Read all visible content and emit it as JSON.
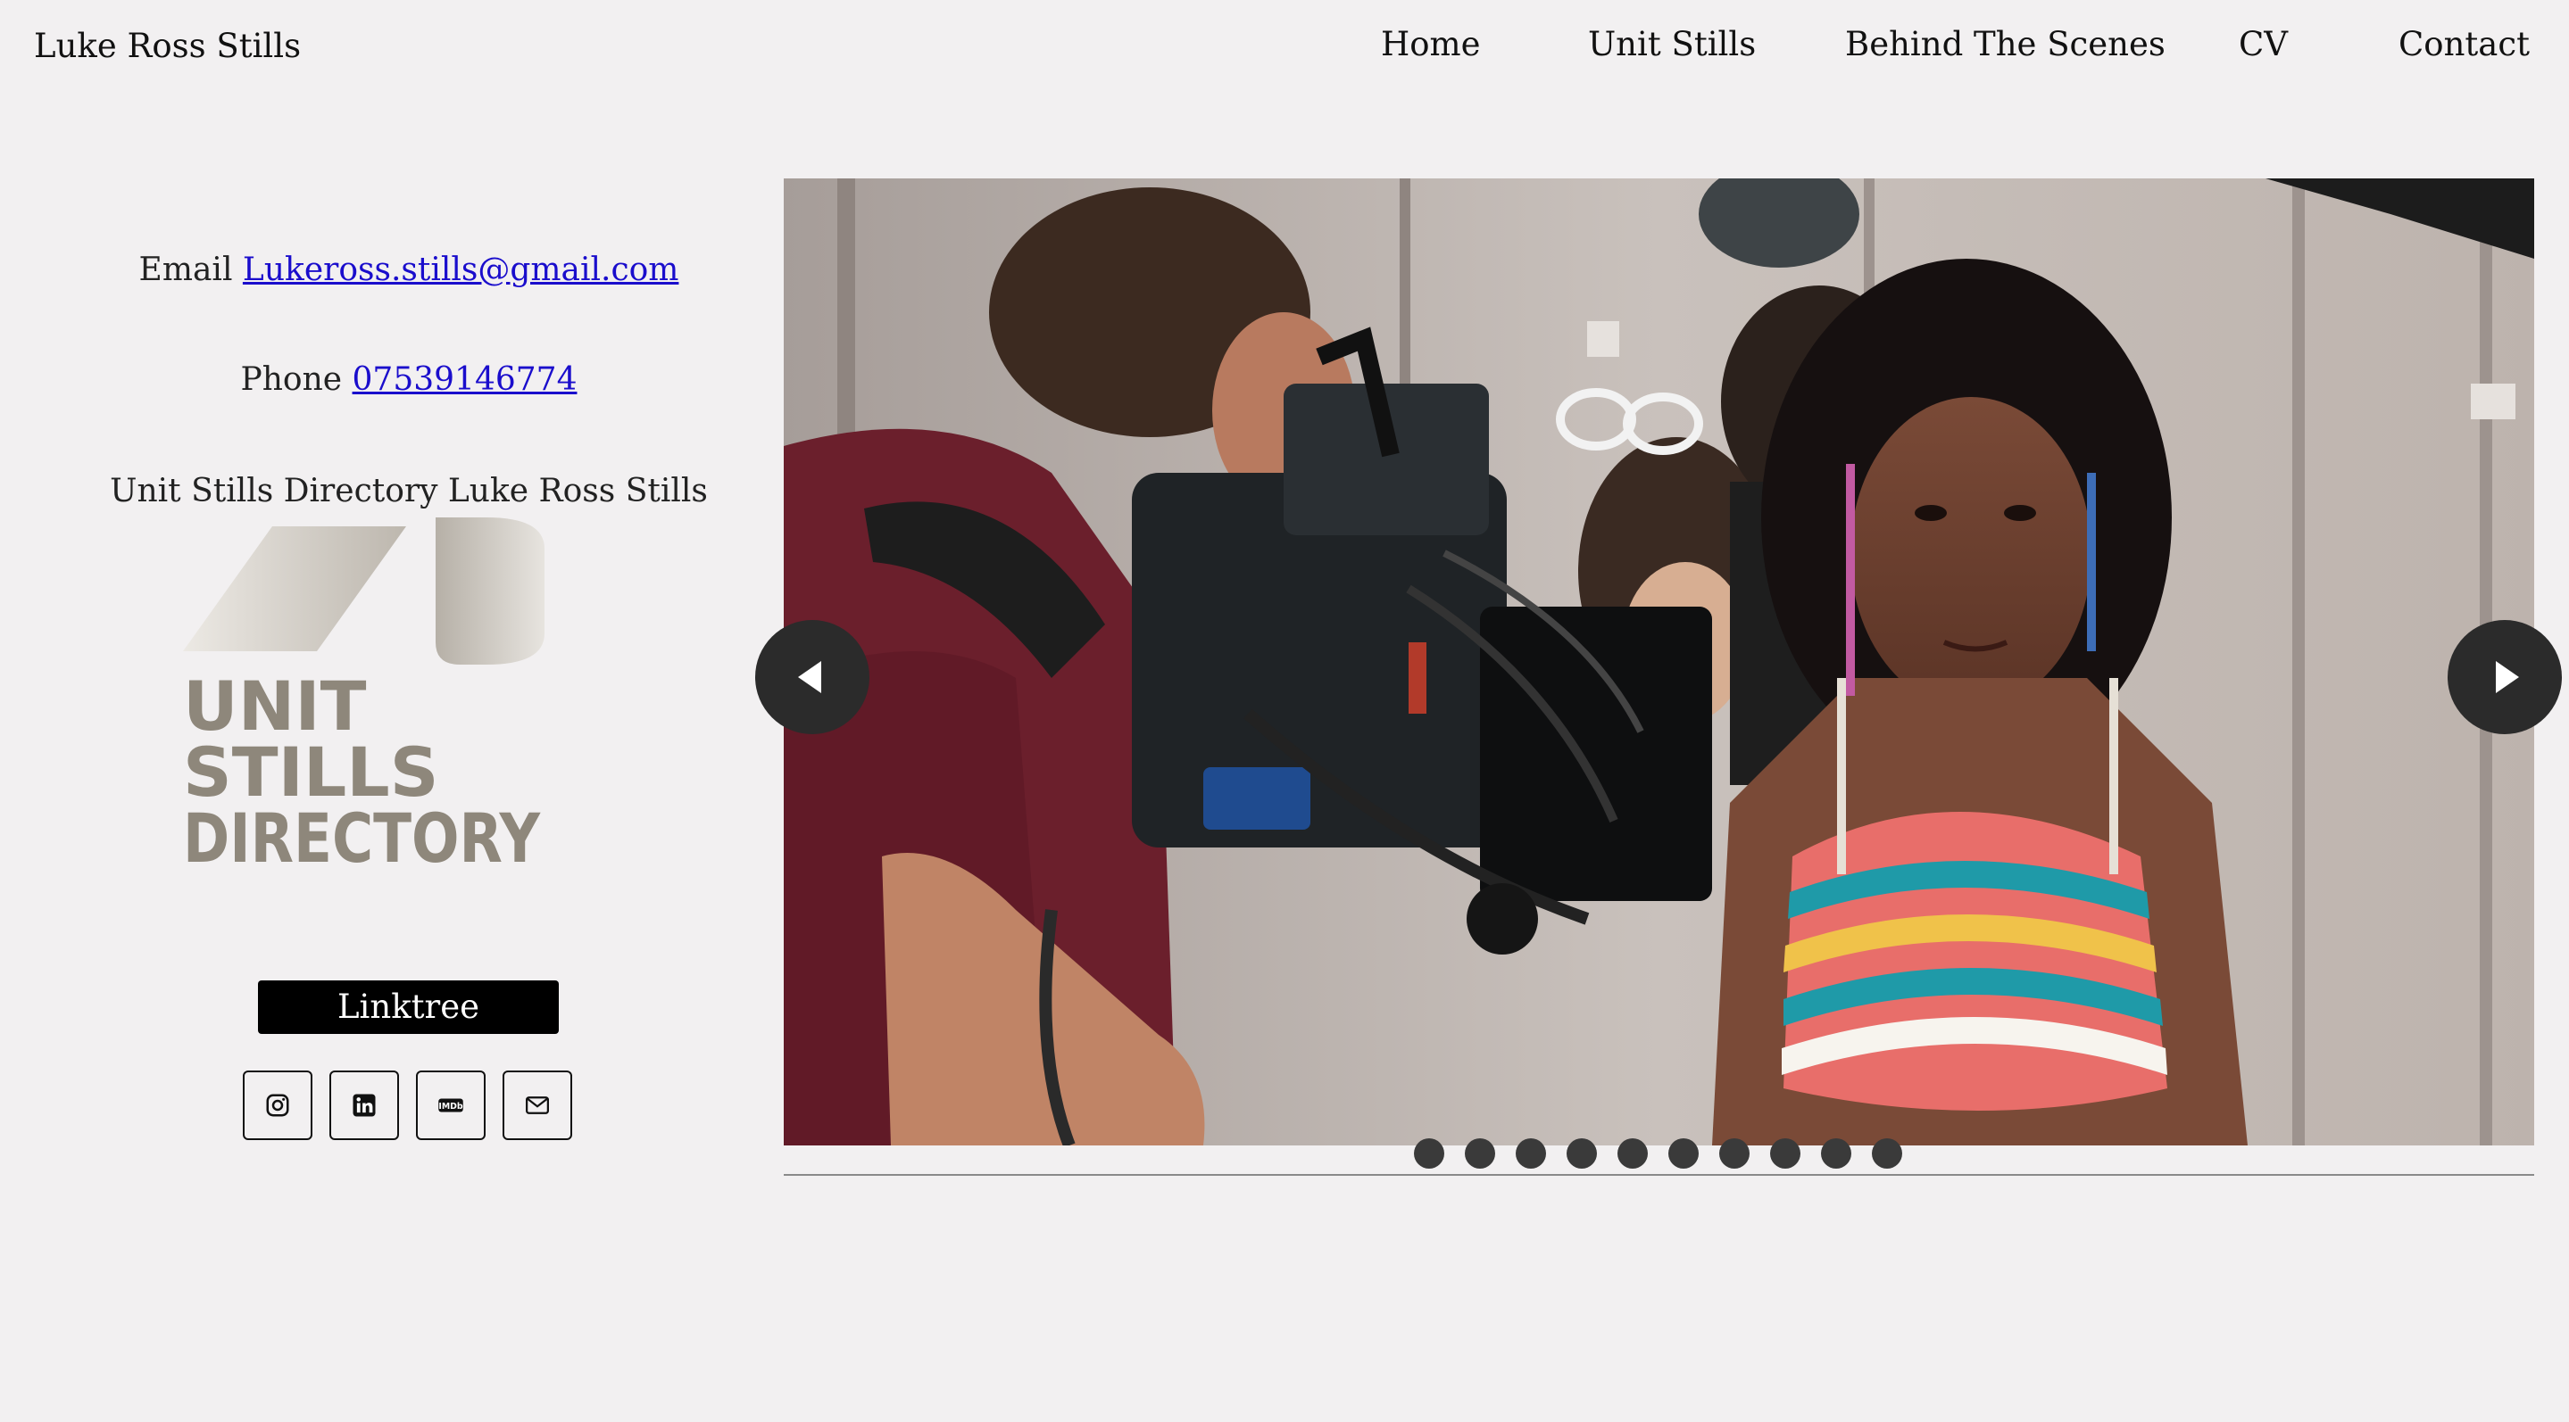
{
  "site": {
    "title": "Luke Ross Stills"
  },
  "nav": {
    "items": [
      "Home",
      "Unit Stills",
      "Behind The Scenes",
      "CV",
      "Contact"
    ]
  },
  "contact": {
    "email_label": "Email",
    "email": "Lukeross.stills@gmail.com",
    "phone_label": "Phone",
    "phone": "07539146774",
    "directory_text": "Unit Stills Directory Luke Ross Stills"
  },
  "logo": {
    "lines": [
      "UNIT",
      "STILLS",
      "DIRECTORY"
    ]
  },
  "linktree": {
    "label": "Linktree"
  },
  "social": {
    "icons": [
      "instagram-icon",
      "linkedin-icon",
      "imdb-icon",
      "mail-icon"
    ],
    "imdb_text": "IMDb"
  },
  "slider": {
    "slide_count": 10,
    "current_slide": 1,
    "controls": [
      "previous-arrow-icon",
      "next-arrow-icon"
    ]
  },
  "colors": {
    "background": "#f2f0f1",
    "link": "#1a0dcc",
    "arrow_bg": "#2b2b2b",
    "logo_text": "#8e877b"
  }
}
